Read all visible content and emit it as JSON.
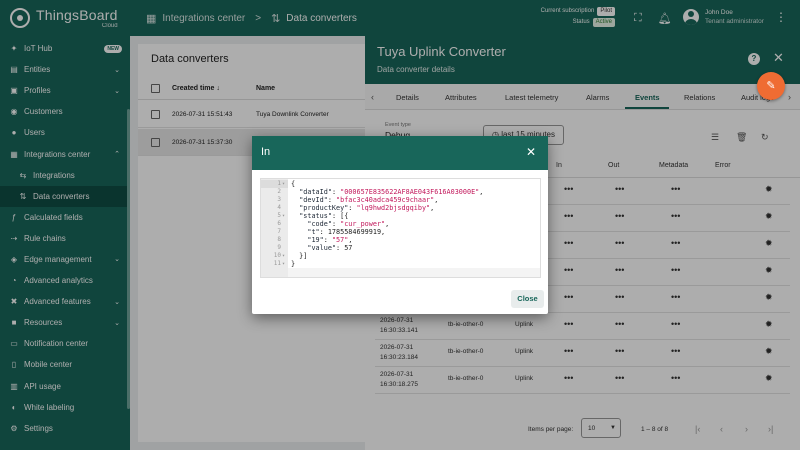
{
  "brand": {
    "name": "ThingsBoard",
    "sub": "Cloud"
  },
  "breadcrumbs": {
    "first": "Integrations center",
    "second": "Data converters"
  },
  "subscription": {
    "label": "Current subscription",
    "plan": "Pilot",
    "status_label": "Status",
    "status": "Active"
  },
  "user": {
    "name": "John Doe",
    "role": "Tenant administrator"
  },
  "sidebar": {
    "items": [
      {
        "label": "IoT Hub",
        "badge": "NEW"
      },
      {
        "label": "Entities"
      },
      {
        "label": "Profiles"
      },
      {
        "label": "Customers"
      },
      {
        "label": "Users"
      },
      {
        "label": "Integrations center"
      },
      {
        "label": "Integrations"
      },
      {
        "label": "Data converters"
      },
      {
        "label": "Calculated fields"
      },
      {
        "label": "Rule chains"
      },
      {
        "label": "Edge management"
      },
      {
        "label": "Advanced analytics"
      },
      {
        "label": "Advanced features"
      },
      {
        "label": "Resources"
      },
      {
        "label": "Notification center"
      },
      {
        "label": "Mobile center"
      },
      {
        "label": "API usage"
      },
      {
        "label": "White labeling"
      },
      {
        "label": "Settings"
      }
    ]
  },
  "list": {
    "title": "Data converters",
    "col_time": "Created time",
    "col_name": "Name",
    "rows": [
      {
        "time": "2026-07-31 15:51:43",
        "name": "Tuya Downlink Converter"
      },
      {
        "time": "2026-07-31 15:37:30",
        "name": ""
      }
    ]
  },
  "drawer": {
    "title": "Tuya Uplink Converter",
    "subtitle": "Data converter details",
    "tabs": [
      "Details",
      "Attributes",
      "Latest telemetry",
      "Alarms",
      "Events",
      "Relations",
      "Audit logs"
    ],
    "active_tab": "Events",
    "event_type_label": "Event type",
    "event_type_value": "Debug",
    "time_window": "last 15 minutes",
    "columns": {
      "in": "In",
      "out": "Out",
      "metadata": "Metadata",
      "error": "Error"
    },
    "rows": [
      {
        "date": "",
        "time": "",
        "server": "",
        "type": ""
      },
      {
        "date": "",
        "time": "",
        "server": "",
        "type": ""
      },
      {
        "date": "",
        "time": "",
        "server": "",
        "type": ""
      },
      {
        "date": "",
        "time": "",
        "server": "",
        "type": ""
      },
      {
        "date": "",
        "time": "",
        "server": "",
        "type": ""
      },
      {
        "date": "2026-07-31",
        "time": "16:30:33.141",
        "server": "tb-ie-other-0",
        "type": "Uplink"
      },
      {
        "date": "2026-07-31",
        "time": "16:30:23.184",
        "server": "tb-ie-other-0",
        "type": "Uplink"
      },
      {
        "date": "2026-07-31",
        "time": "16:30:18.275",
        "server": "tb-ie-other-0",
        "type": "Uplink"
      }
    ],
    "pager": {
      "items_label": "Items per page:",
      "page_size": "10",
      "range": "1 – 8 of 8"
    }
  },
  "dialog": {
    "title": "In",
    "close_label": "Close",
    "code_lines": [
      "{",
      "  \"dataId\": \"000657E835622AF8AE043F616A03000E\",",
      "  \"devId\": \"bfac3c40adca459c9chaar\",",
      "  \"productKey\": \"lq9hwd2bjsdgqiby\",",
      "  \"status\": [{",
      "    \"code\": \"cur_power\",",
      "    \"t\": 1785584699919,",
      "    \"19\": \"57\",",
      "    \"value\": 57",
      "  }]",
      "}"
    ]
  },
  "colors": {
    "primary": "#18665a",
    "accent": "#ef6c33"
  }
}
